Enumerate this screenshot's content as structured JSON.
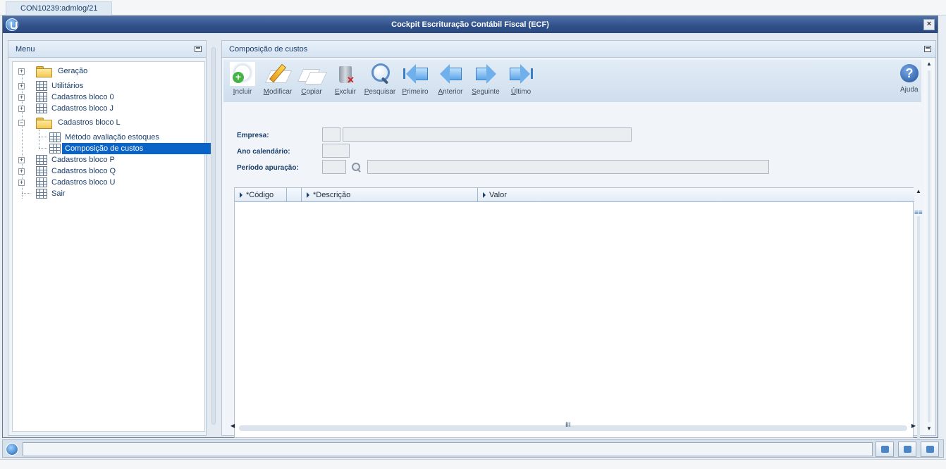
{
  "session": {
    "tab_label": "CON10239:admlog/21"
  },
  "window": {
    "title": "Cockpit Escrituração Contábil Fiscal (ECF)",
    "close_symbol": "×"
  },
  "menu": {
    "title": "Menu",
    "items": [
      {
        "label": "Geração",
        "type": "folder",
        "expanded": false
      },
      {
        "label": "Utilitários",
        "type": "grid",
        "expanded": false
      },
      {
        "label": "Cadastros bloco 0",
        "type": "grid",
        "expanded": false
      },
      {
        "label": "Cadastros bloco J",
        "type": "grid",
        "expanded": false
      },
      {
        "label": "Cadastros bloco L",
        "type": "folder",
        "expanded": true,
        "children": [
          {
            "label": "Método avaliação estoques",
            "selected": false
          },
          {
            "label": "Composição de custos",
            "selected": true
          }
        ]
      },
      {
        "label": "Cadastros bloco P",
        "type": "grid",
        "expanded": false
      },
      {
        "label": "Cadastros bloco Q",
        "type": "grid",
        "expanded": false
      },
      {
        "label": "Cadastros bloco U",
        "type": "grid",
        "expanded": false
      },
      {
        "label": "Sair",
        "type": "grid"
      }
    ]
  },
  "content": {
    "title": "Composição de custos",
    "toolbar": [
      {
        "label": "Incluir",
        "icon": "add-document-icon"
      },
      {
        "label": "Modificar",
        "icon": "edit-pencil-icon"
      },
      {
        "label": "Copiar",
        "icon": "copy-icon"
      },
      {
        "label": "Excluir",
        "icon": "trash-icon"
      },
      {
        "label": "Pesquisar",
        "icon": "magnifier-icon"
      },
      {
        "label": "Primeiro",
        "icon": "first-arrow-icon"
      },
      {
        "label": "Anterior",
        "icon": "previous-arrow-icon"
      },
      {
        "label": "Seguinte",
        "icon": "next-arrow-icon"
      },
      {
        "label": "Último",
        "icon": "last-arrow-icon"
      }
    ],
    "help": {
      "label": "Ajuda",
      "icon": "help-icon",
      "symbol": "?"
    },
    "form": {
      "empresa_label": "Empresa:",
      "empresa_code": "",
      "empresa_name": "",
      "ano_label": "Ano calendário:",
      "ano_value": "",
      "periodo_label": "Período apuração:",
      "periodo_code": "",
      "periodo_desc": ""
    },
    "grid": {
      "columns": [
        "*Código",
        "",
        "*Descrição",
        "Valor"
      ],
      "rows": []
    },
    "scroll_symbols": {
      "up": "▲",
      "down": "▼",
      "left": "◀",
      "right": "▶",
      "grip": "III",
      "bars": "≡≡"
    }
  },
  "colors": {
    "title_bar": "#2f4f88",
    "selection": "#0a63c7",
    "panel_header": "#d5e3f1"
  }
}
